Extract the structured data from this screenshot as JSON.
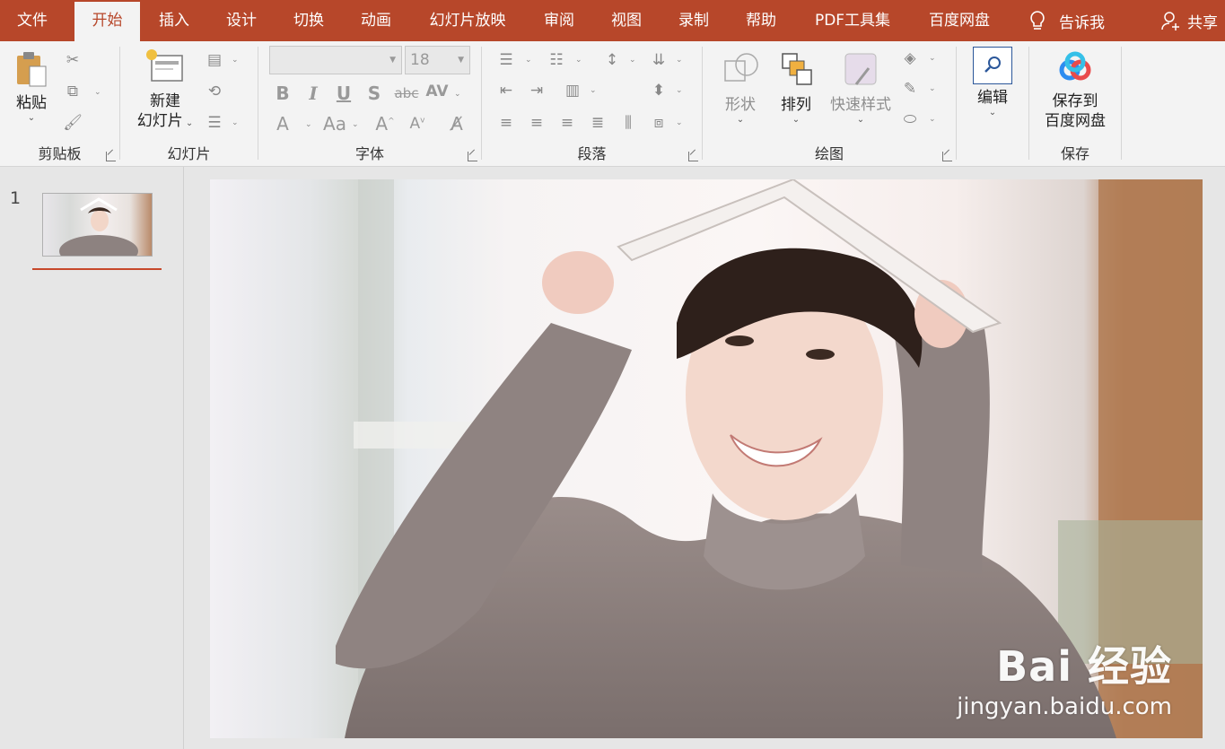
{
  "tabs": [
    "文件",
    "开始",
    "插入",
    "设计",
    "切换",
    "动画",
    "幻灯片放映",
    "审阅",
    "视图",
    "录制",
    "帮助",
    "PDF工具集",
    "百度网盘"
  ],
  "active_tab": "开始",
  "tell_me": "告诉我",
  "share": "共享",
  "ribbon": {
    "clipboard": {
      "label": "剪贴板",
      "paste": "粘贴"
    },
    "slides": {
      "label": "幻灯片",
      "new_slide_line1": "新建",
      "new_slide_line2": "幻灯片"
    },
    "font": {
      "label": "字体",
      "font_name": "",
      "font_size": "18"
    },
    "paragraph": {
      "label": "段落"
    },
    "drawing": {
      "label": "绘图",
      "shapes": "形状",
      "arrange": "排列",
      "quick_styles": "快速样式"
    },
    "editing": {
      "label": "编辑"
    },
    "save": {
      "label": "保存",
      "save_to_line1": "保存到",
      "save_to_line2": "百度网盘"
    }
  },
  "slides_pane": {
    "slide_number": "1"
  },
  "slide": {
    "watermark_main": "Bai 经验",
    "watermark_sub": "jingyan.baidu.com"
  },
  "colors": {
    "accent": "#b7472a",
    "ribbon_bg": "#f3f3f3",
    "workspace": "#e6e6e6"
  }
}
